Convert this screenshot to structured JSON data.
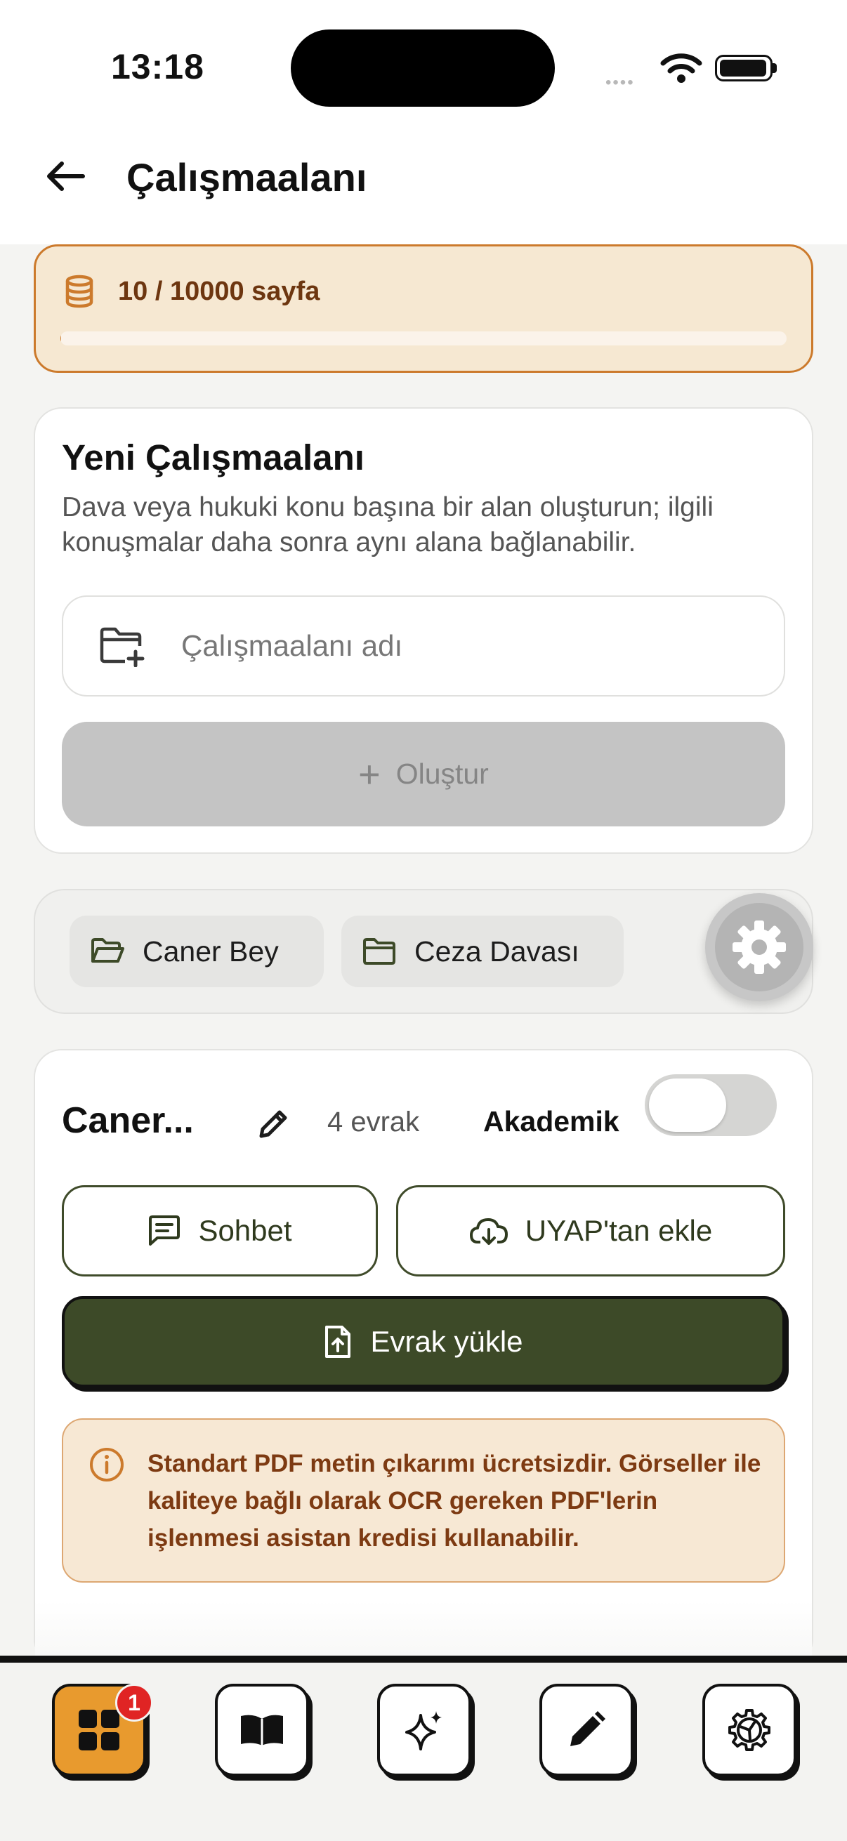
{
  "status_bar": {
    "time": "13:18",
    "dots": "••••"
  },
  "header": {
    "back_label": "",
    "title": "Çalışmaalanı"
  },
  "quota": {
    "text": "10 / 10000 sayfa",
    "used_fraction": 0.001
  },
  "create_card": {
    "title": "Yeni Çalışmaalanı",
    "description": "Dava veya hukuki konu başına bir alan oluşturun; ilgili konuşmalar daha sonra aynı alana bağlanabilir.",
    "name_placeholder": "Çalışmaalanı adı",
    "name_value": "",
    "create_plus": "+",
    "create_label": "Oluştur"
  },
  "workspaces": {
    "items": [
      {
        "label": "Caner Bey",
        "icon": "folder-open-icon"
      },
      {
        "label": "Ceza Davası",
        "icon": "folder-icon"
      }
    ],
    "settings_icon": "gear-icon"
  },
  "detail": {
    "name": "Caner...",
    "doc_count": "4 evrak",
    "academic_label": "Akademik",
    "academic_on": false,
    "chat_label": "Sohbet",
    "uyap_label": "UYAP'tan ekle",
    "upload_label": "Evrak yükle",
    "notice": "Standart PDF metin çıkarımı ücretsizdir. Görseller ile kaliteye bağlı olarak OCR gereken PDF'lerin işlenmesi asistan kredisi kullanabilir."
  },
  "bottom_nav": {
    "items": [
      {
        "icon": "grid-icon",
        "active": true
      },
      {
        "icon": "book-icon",
        "active": false
      },
      {
        "icon": "sparkles-icon",
        "active": false
      },
      {
        "icon": "pencil-icon",
        "active": false
      },
      {
        "icon": "gear-icon",
        "active": false
      }
    ],
    "badge": "1"
  },
  "colors": {
    "accent_orange": "#cc7a2c",
    "quota_bg": "#f6e8d2",
    "primary_green": "#3d4a28",
    "nav_active": "#e89a2e",
    "badge_red": "#e02424"
  }
}
